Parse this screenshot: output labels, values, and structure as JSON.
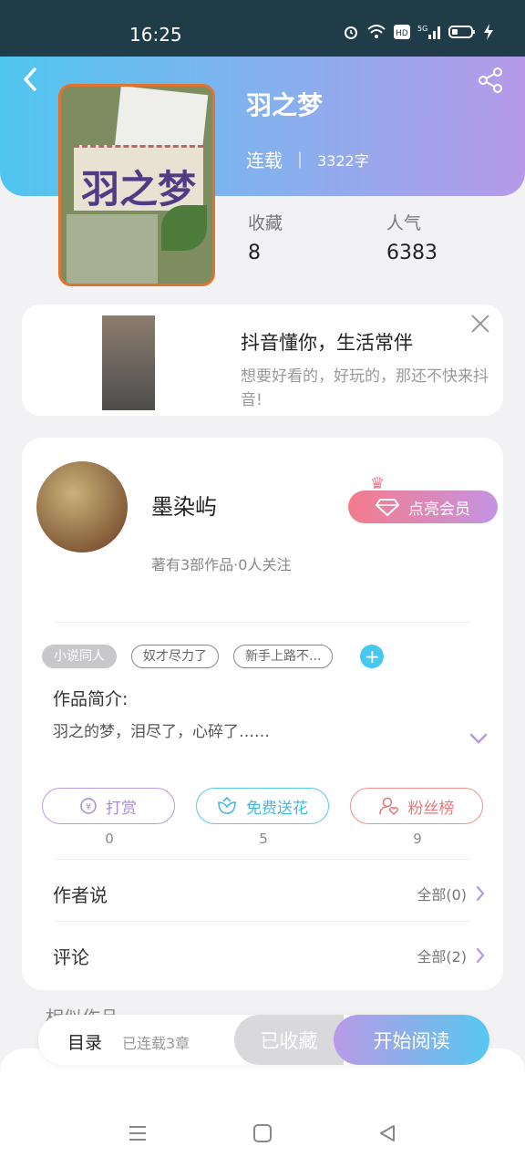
{
  "status_bar": {
    "time": "16:25",
    "icons": [
      "alarm-icon",
      "wifi-icon",
      "hd-icon",
      "5g-signal-icon",
      "battery-icon",
      "charging-icon"
    ]
  },
  "book": {
    "title": "羽之梦",
    "status": "连载",
    "words": "3322字",
    "cover_title": "羽之梦",
    "stats": [
      {
        "label": "收藏",
        "value": "8"
      },
      {
        "label": "人气",
        "value": "6383"
      }
    ]
  },
  "ad": {
    "title": "抖音懂你，生活常伴",
    "desc": "想要好看的，好玩的，那还不快来抖音!"
  },
  "author": {
    "name": "墨染屿",
    "sub": "著有3部作品·0人关注",
    "vip_label": "点亮会员"
  },
  "tags": [
    "小说同人",
    "奴才尽力了",
    "新手上路不..."
  ],
  "intro": {
    "title": "作品简介:",
    "text": "羽之的梦，泪尽了，心碎了……"
  },
  "actions": [
    {
      "label": "打赏",
      "count": "0"
    },
    {
      "label": "免费送花",
      "count": "5"
    },
    {
      "label": "粉丝榜",
      "count": "9"
    }
  ],
  "rows": [
    {
      "title": "作者说",
      "right": "全部(0)"
    },
    {
      "title": "评论",
      "right": "全部(2)"
    }
  ],
  "similar_title": "相似作品",
  "bottom_bar": {
    "toc": "目录",
    "chapters": "已连载3章",
    "collected": "已收藏",
    "read": "开始阅读"
  },
  "colors": {
    "hero_gradient_start": "#4fc6ef",
    "hero_gradient_end": "#b69ae9",
    "vip_start": "#f47b8b",
    "vip_end": "#c494e2",
    "accent_blue": "#47c8ef"
  }
}
